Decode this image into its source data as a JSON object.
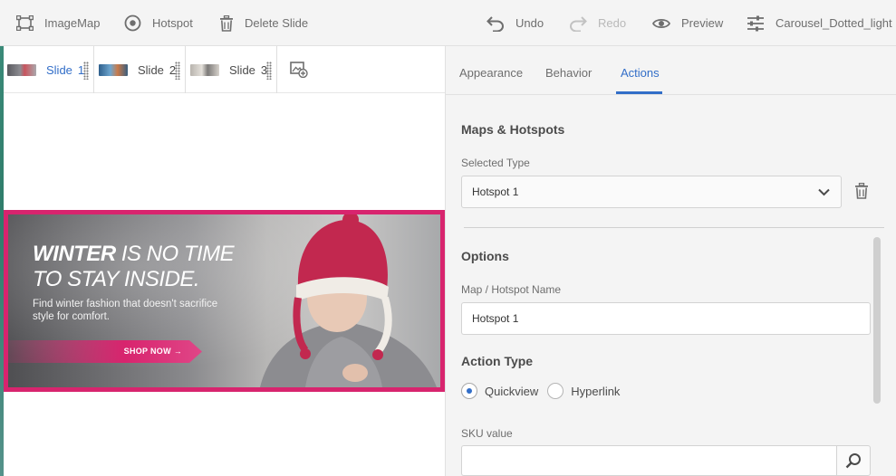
{
  "toolbar": {
    "imagemap_label": "ImageMap",
    "hotspot_label": "Hotspot",
    "delete_slide_label": "Delete Slide",
    "undo_label": "Undo",
    "redo_label": "Redo",
    "preview_label": "Preview",
    "preset_label": "Carousel_Dotted_light"
  },
  "slides": [
    {
      "label": "Slide",
      "number": "1",
      "active": true
    },
    {
      "label": "Slide",
      "number": "2",
      "active": false
    },
    {
      "label": "Slide",
      "number": "3",
      "active": false
    }
  ],
  "banner": {
    "headline_bold": "WINTER",
    "headline_rest": " IS NO TIME",
    "headline_line2": "TO STAY INSIDE.",
    "subtext": "Find winter fashion that doesn't sacrifice style for comfort.",
    "cta": "SHOP NOW →"
  },
  "panel": {
    "tabs": [
      "Appearance",
      "Behavior",
      "Actions"
    ],
    "active_tab": "Actions",
    "maps_heading": "Maps & Hotspots",
    "selected_type_label": "Selected Type",
    "selected_type_value": "Hotspot 1",
    "options_heading": "Options",
    "name_label": "Map / Hotspot Name",
    "name_value": "Hotspot 1",
    "action_type_heading": "Action Type",
    "action_options": [
      "Quickview",
      "Hyperlink"
    ],
    "action_selected": "Quickview",
    "sku_label": "SKU value",
    "sku_value": ""
  },
  "colors": {
    "accent": "#326ec8",
    "banner_border": "#d8246e"
  }
}
